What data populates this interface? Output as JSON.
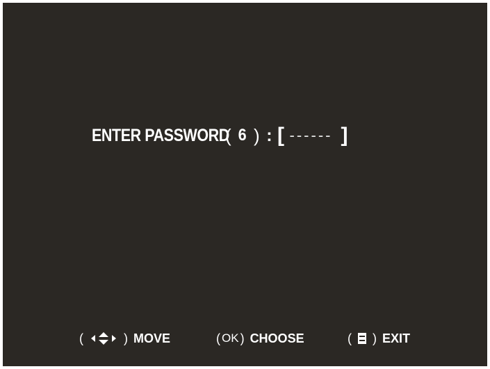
{
  "password_prompt": {
    "label": "ENTER PASSWORD",
    "open_paren": "(",
    "length": "6",
    "close_paren": ")",
    "colon": ":",
    "open_bracket": "[",
    "placeholder": "------",
    "close_bracket": "]"
  },
  "hints": {
    "move": {
      "open_paren": "(",
      "close_paren": ")",
      "label": "MOVE",
      "icon": "arrow-keys-icon"
    },
    "choose": {
      "open_paren": "(",
      "key": "OK",
      "close_paren": ")",
      "label": "CHOOSE"
    },
    "exit": {
      "open_paren": "(",
      "close_paren": ")",
      "label": "EXIT",
      "icon": "menu-key-icon"
    }
  },
  "colors": {
    "background": "#2b2824",
    "text": "#ffffff"
  }
}
